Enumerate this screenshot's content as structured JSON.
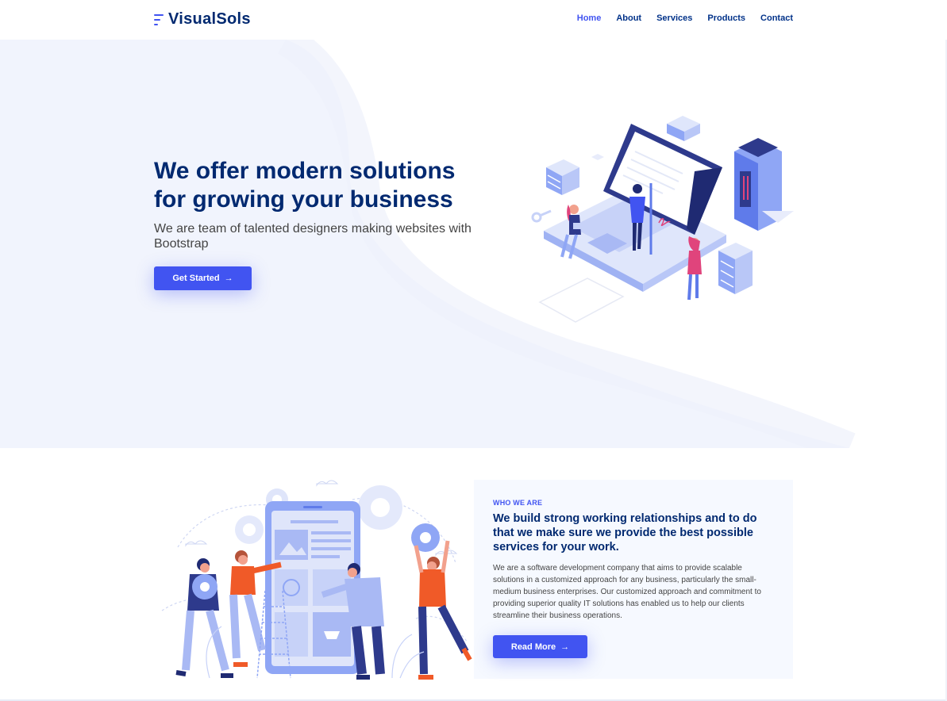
{
  "brand": {
    "name": "VisualSols"
  },
  "nav": {
    "items": [
      {
        "label": "Home",
        "active": true
      },
      {
        "label": "About",
        "active": false
      },
      {
        "label": "Services",
        "active": false
      },
      {
        "label": "Products",
        "active": false
      },
      {
        "label": "Contact",
        "active": false
      }
    ]
  },
  "hero": {
    "title": "We offer modern solutions for growing your business",
    "subtitle": "We are team of talented designers making websites with Bootstrap",
    "cta_label": "Get Started",
    "cta_icon": "arrow-right-icon",
    "illustration": "isometric-laptop-team-illustration"
  },
  "about": {
    "eyebrow": "WHO WE ARE",
    "title": "We build strong working relationships and to do that we make sure we provide the best possible services for your work.",
    "text": "We are a software development company that aims to provide scalable solutions in a customized approach for any business, particularly the small-medium business enterprises. Our customized approach and commitment to providing superior quality IT solutions has enabled us to help our clients streamline their business operations.",
    "cta_label": "Read More",
    "cta_icon": "arrow-right-icon",
    "illustration": "team-building-app-illustration"
  },
  "colors": {
    "accent": "#4154f1",
    "heading": "#012970",
    "text": "#444444",
    "hero_bg": "#f3f5fd",
    "box_bg": "#f6f9ff"
  }
}
